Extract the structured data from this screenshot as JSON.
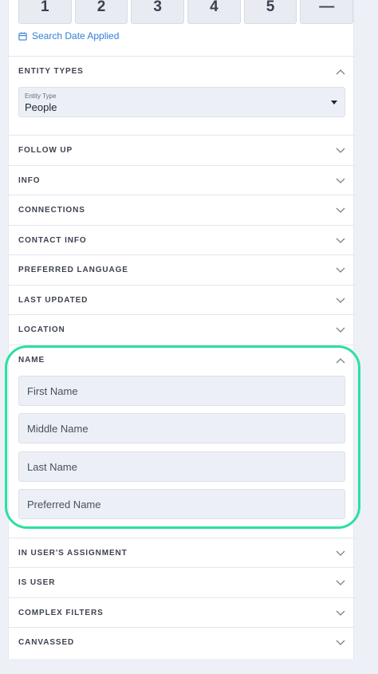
{
  "number_buttons": [
    "1",
    "2",
    "3",
    "4",
    "5",
    "—"
  ],
  "search_date_link": "Search Date Applied",
  "entity_types": {
    "title": "ENTITY TYPES",
    "select_label": "Entity Type",
    "select_value": "People"
  },
  "sections": {
    "follow_up": "FOLLOW UP",
    "info": "INFO",
    "connections": "CONNECTIONS",
    "contact_info": "CONTACT INFO",
    "preferred_language": "PREFERRED LANGUAGE",
    "last_updated": "LAST UPDATED",
    "location": "LOCATION",
    "in_users_assignment": "IN USER'S ASSIGNMENT",
    "is_user": "IS USER",
    "complex_filters": "COMPLEX FILTERS",
    "canvassed": "CANVASSED"
  },
  "name": {
    "title": "NAME",
    "first_placeholder": "First Name",
    "middle_placeholder": "Middle Name",
    "last_placeholder": "Last Name",
    "preferred_placeholder": "Preferred Name"
  },
  "colors": {
    "link": "#2f7fd8",
    "highlight": "#2be0a0",
    "background": "#eef0f7"
  }
}
